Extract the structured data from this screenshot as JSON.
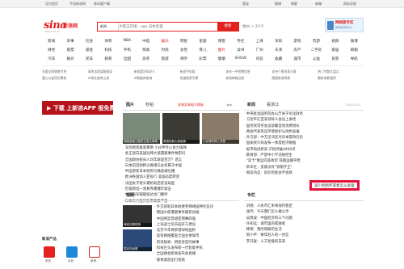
{
  "topbar": {
    "left": [
      "设为首页",
      "手机新浪网",
      "移动客户端"
    ],
    "right": [
      "登录",
      "微博",
      "博客",
      "邮箱",
      "网站导航"
    ]
  },
  "logo": {
    "mark": "sina",
    "name": "新浪网",
    "url": "sina.com.cn"
  },
  "search": {
    "select": "新闻",
    "placeholder": "大家正在搜：ego 日本巨蛋",
    "button": "搜索"
  },
  "weather": "杭州 ☼ 21℃",
  "rightad": {
    "title": "网络版专区",
    "sub": "新浪游戏中心"
  },
  "nav": [
    [
      "新闻",
      "军事",
      "社会",
      "体育",
      "NBA",
      "中超",
      "娱乐",
      "明星",
      "星座",
      "博客",
      "专栏",
      "上海",
      "深圳",
      "游戏",
      "页游",
      "视频",
      "微博"
    ],
    [
      "财经",
      "股票",
      "基金",
      "科技",
      "手机",
      "探索",
      "时尚",
      "女性",
      "育儿",
      "图片",
      "读书",
      "广州",
      "天津",
      "房产",
      "二手房",
      "家居",
      "邮箱"
    ],
    [
      "汽车",
      "报价",
      "买车",
      "教育",
      "出国",
      "高考",
      "旅游",
      "佛学",
      "彩票",
      "健康",
      "SHOW",
      "问答",
      "收藏",
      "城市",
      "公益",
      "背景",
      "导航"
    ]
  ],
  "nav_highlight": [
    [
      6
    ],
    [
      9
    ],
    []
  ],
  "links": [
    [
      "无需全网销售专供",
      "高考志愿填报指导",
      "新浪爱问知识人",
      "新浪手机版",
      "安庆一中招聘信息",
      "支持个税改革方案",
      "热门专题大盘点"
    ],
    [
      "爱心公益项目筹款",
      "IP地址查询工具",
      "IP数据库查询",
      "快速搜索引擎",
      "新浪邮箱注册",
      "搜狐新浪网易",
      "最新电影推荐"
    ]
  ],
  "adbanner": "▶ 下载 上新浪APP 报免费",
  "middle": {
    "tabs": [
      "图片",
      "秒拍"
    ],
    "promo": "金装奖来临大揭秘",
    "nav_arrows": "◀ ▶",
    "photos": [
      {
        "caption": "湖南高速公路发生重大事故"
      },
      {
        "caption": "美国驻韩大使被袭"
      },
      {
        "caption": "小伙骑车掉入河里"
      }
    ],
    "news": [
      "深圳地铁乘客晕倒 小伙伴齐心协力施救",
      "金正恩向美国驻韩大使遇袭事件致慰问",
      "全国政协委员人均年薪超百万？谣言",
      "日本前首相称尖阁诸岛主权属于中国",
      "中国游客日本抢购马桶盖被吐槽",
      "欧洲各国加入亚投行 美国态度转变",
      "法国女子街头遭抢劫后反追劫匪",
      "巴基斯坦一清真寺遭爆炸袭击",
      "中国海军舰艇抵达也门撤侨",
      "日本央行维持货币政策不变"
    ]
  },
  "right": {
    "tabs": [
      "新闻",
      "看浙江"
    ],
    "date": "2015.4.23",
    "news": [
      "中央批准国务院办公厅关于优化政务",
      "习近平在亚非领导人会议上讲话",
      "国务院常务会议部署促进消费增长",
      "两会代表热议环境保护与绿色发展",
      "外交部：中方坚决反对日本篡改历史",
      "国家统计局发布一季度经济数据",
      "股市再创新高 沪指突破4400点",
      "教育部：严禁中小学违规招生",
      "\"双卡\"春运完美收官 铁路运输平稳",
      "新华社：反腐没有\"铁帽子王\"",
      "网友热议：房价到底会不会跌"
    ]
  },
  "video": {
    "tab": "视频",
    "news": [
      "外交部就日本政要参拜靖国神社答问",
      "韩国大使遭袭事件最新进展",
      "中国男篮晋级亚锦赛四强",
      "上海迪士尼乐园开工建设",
      "北京今年将新增绿地面积",
      "高铁网络覆盖全国主要城市",
      "新浪独家：明星背后的故事",
      "科技巨头发布新一代智能手机",
      "全国两会新闻发布会直播",
      "春季旅游出行指南"
    ],
    "photo_captions": [
      "港姐决赛现场",
      "国足热身赛"
    ]
  },
  "column": {
    "tab": "专栏",
    "items": [
      "刘晓：人民币汇率将保持稳定",
      "张鸣：今天我们怎么做父亲",
      "吴晓波：中国经济的三个问题",
      "许知远：城市里的孤独者",
      "韩寒：我所理解的生活",
      "周小平：致年轻人的一封信",
      "李开复：人工智能的未来"
    ],
    "highlight_text": "减少别损坏或者怎么处理"
  },
  "products": {
    "title": "新浪产品",
    "items": [
      "新浪",
      "体育",
      "微博",
      "视频"
    ]
  },
  "colors": {
    "brand_red": "#e3211e",
    "highlight_border": "#e3123a"
  }
}
